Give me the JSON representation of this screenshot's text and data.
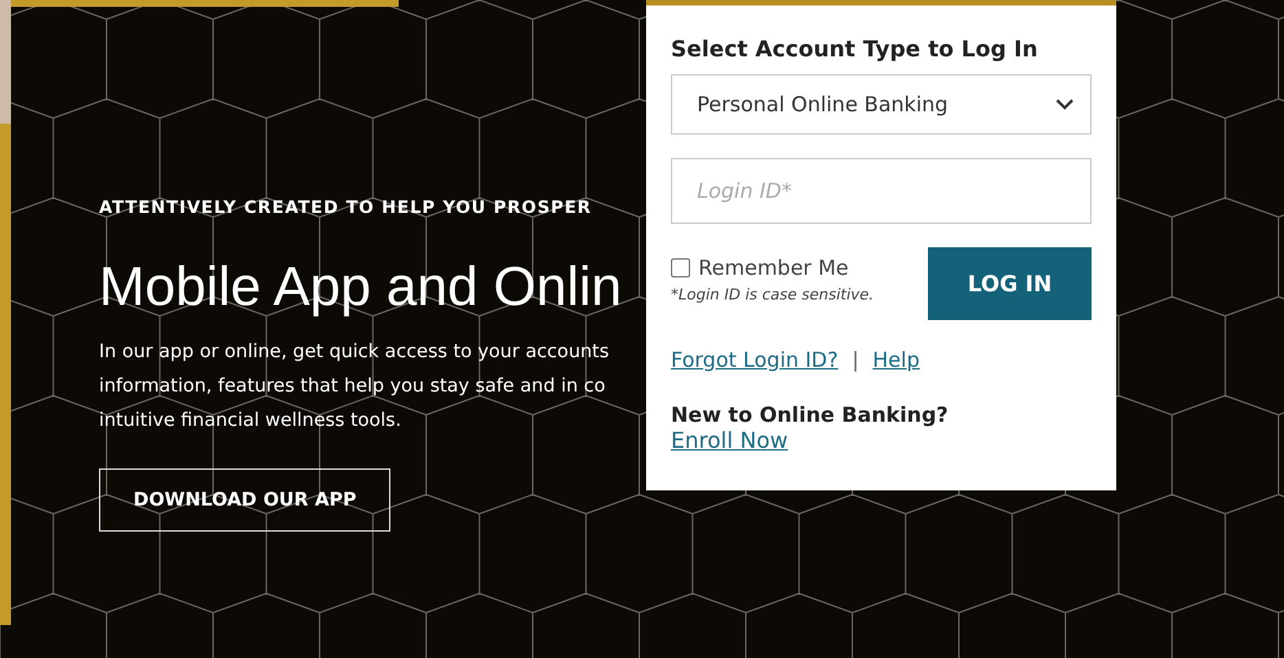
{
  "hero": {
    "eyebrow": "ATTENTIVELY CREATED TO HELP YOU PROSPER",
    "title": "Mobile App and Onlin",
    "body_lines": [
      "In our app or online, get quick access to your accounts",
      "information, features that help you stay safe and in co",
      "intuitive financial wellness tools."
    ],
    "button": "DOWNLOAD OUR APP"
  },
  "login": {
    "title": "Select Account Type to Log In",
    "account_type": "Personal Online Banking",
    "login_field": {
      "placeholder": "Login ID*"
    },
    "remember": {
      "label": "Remember Me",
      "checked": false
    },
    "note": "*Login ID is case sensitive.",
    "button": "LOG IN",
    "links": [
      "Forgot Login ID?",
      "Help"
    ],
    "separator": "|",
    "enroll_title": "New to Online Banking?",
    "enroll_link": "Enroll Now"
  }
}
